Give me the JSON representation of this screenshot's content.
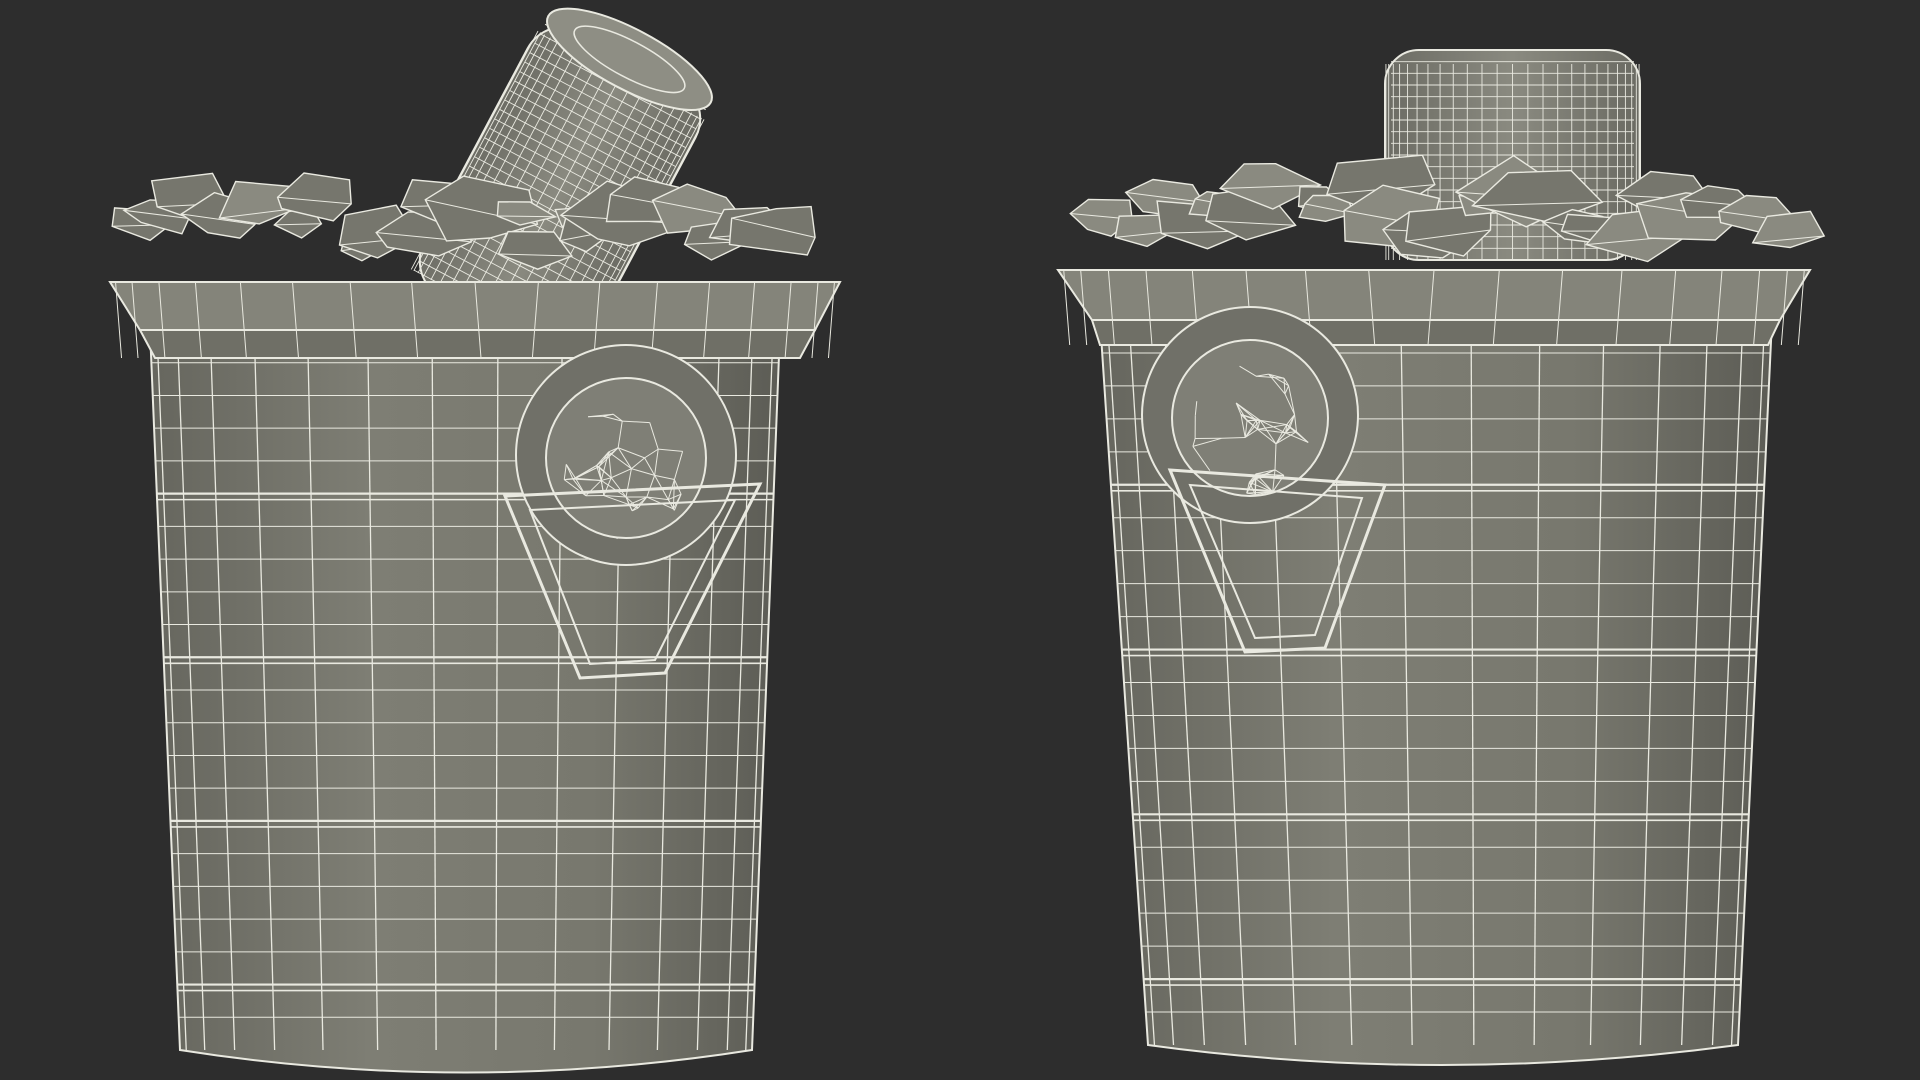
{
  "scene": {
    "background_color": "#2d2d2d",
    "shaded_color": "#7a7a70",
    "shaded_dark": "#5e5e56",
    "wire_color": "#e9e9e0",
    "views": [
      {
        "name": "view-left",
        "icon": "ice-bucket-with-tilted-can"
      },
      {
        "name": "view-right",
        "icon": "ice-bucket-with-upright-can"
      }
    ]
  }
}
